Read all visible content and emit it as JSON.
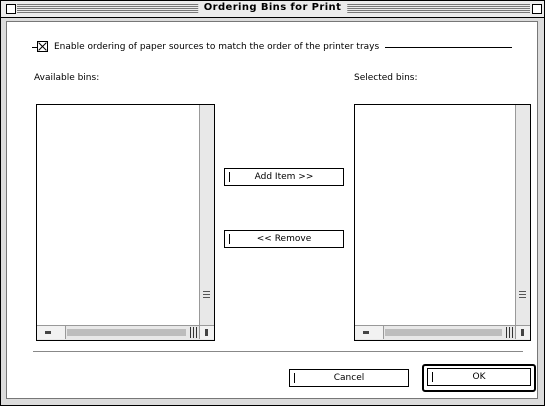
{
  "window": {
    "title": "Ordering Bins for Print"
  },
  "checkbox": {
    "label": "Enable ordering of paper sources to match the order of the printer trays",
    "checked": true
  },
  "available": {
    "label": "Available bins:",
    "items": []
  },
  "selected": {
    "label": "Selected bins:",
    "items": []
  },
  "buttons": {
    "add": "Add Item >>",
    "remove": "<< Remove",
    "cancel": "Cancel",
    "ok": "OK"
  }
}
